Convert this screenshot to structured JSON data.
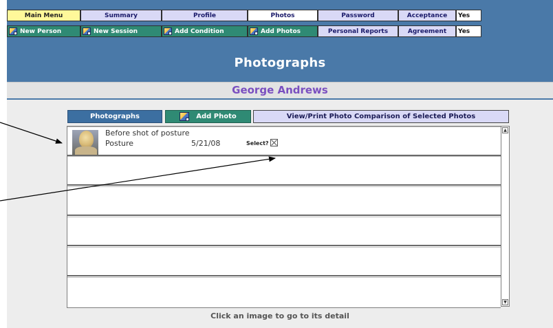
{
  "nav": {
    "row1": [
      {
        "label": "Main Menu",
        "style": "yellow"
      },
      {
        "label": "Summary",
        "style": "lav"
      },
      {
        "label": "Profile",
        "style": "lav"
      },
      {
        "label": "Photos",
        "style": "white"
      },
      {
        "label": "Password",
        "style": "lav"
      },
      {
        "label": "Acceptance",
        "style": "lav"
      },
      {
        "label": "Yes",
        "style": "yes"
      }
    ],
    "row2": [
      {
        "label": "New Person",
        "style": "green",
        "icon": "add-person-icon"
      },
      {
        "label": "New Session",
        "style": "green",
        "icon": "add-session-icon"
      },
      {
        "label": "Add Condition",
        "style": "green",
        "icon": "add-condition-icon"
      },
      {
        "label": "Add Photos",
        "style": "green",
        "icon": "add-photos-icon"
      },
      {
        "label": "Personal Reports",
        "style": "lav"
      },
      {
        "label": "Agreement",
        "style": "lav"
      },
      {
        "label": "Yes",
        "style": "yes"
      }
    ]
  },
  "page": {
    "title": "Photographs",
    "person_name": "George Andrews"
  },
  "tabs": {
    "photos": "Photographs",
    "add_photo": "Add Photo",
    "view_print": "View/Print Photo Comparison of Selected Photos"
  },
  "photos": [
    {
      "description": "Before shot of posture",
      "category": "Posture",
      "date": "5/21/08",
      "select_label": "Select?"
    }
  ],
  "empty_rows": 5,
  "hint": "Click an image to go to its detail",
  "colors": {
    "header_blue": "#4a79a8",
    "name_purple": "#7a4fc0",
    "green_button": "#2f8a74",
    "lavender_button": "#d9d9f6",
    "yellow_button": "#fff89a"
  }
}
